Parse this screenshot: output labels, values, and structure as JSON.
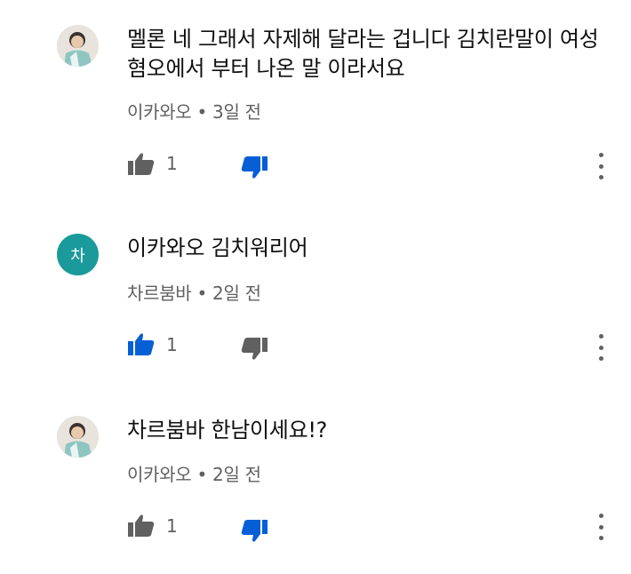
{
  "comments": [
    {
      "avatar": {
        "type": "photo",
        "icon": "user-avatar-photo"
      },
      "text": "멜론 네 그래서 자제해 달라는 겁니다 김치란말이 여성혐오에서 부터 나온 말 이라서요",
      "author": "이카와오",
      "time": "3일 전",
      "likes": "1",
      "liked": false,
      "disliked": true
    },
    {
      "avatar": {
        "type": "letter",
        "letter": "차",
        "color": "#1a9a9a"
      },
      "text": "이카와오 김치워리어",
      "author": "차르붐바",
      "time": "2일 전",
      "likes": "1",
      "liked": true,
      "disliked": false
    },
    {
      "avatar": {
        "type": "photo",
        "icon": "user-avatar-photo"
      },
      "text": "차르붐바 한남이세요!?",
      "author": "이카와오",
      "time": "2일 전",
      "likes": "1",
      "liked": false,
      "disliked": true
    }
  ],
  "colors": {
    "active_blue": "#065fd4",
    "inactive_gray": "#606060"
  }
}
